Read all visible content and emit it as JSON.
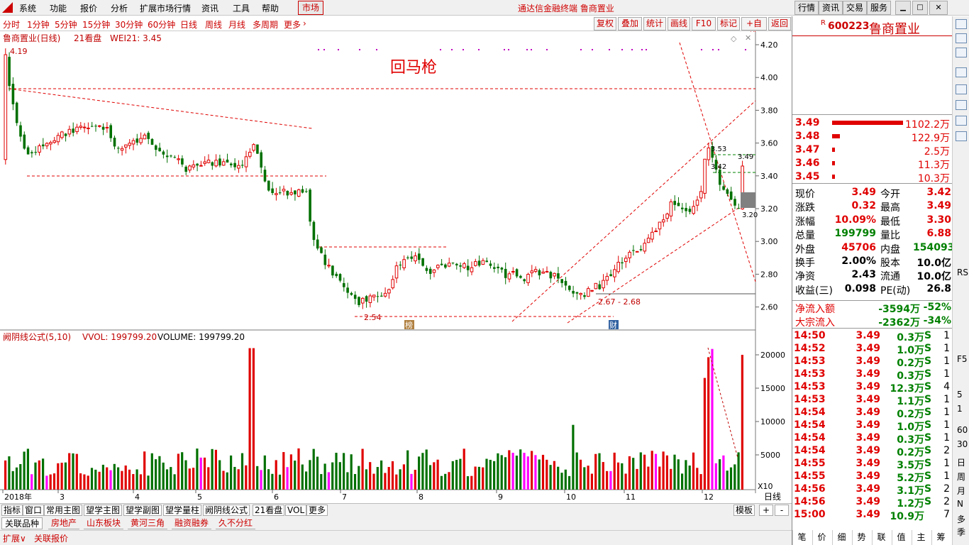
{
  "menu": {
    "items": [
      "系统",
      "功能",
      "报价",
      "分析",
      "扩展市场行情",
      "资讯",
      "工具",
      "帮助"
    ],
    "market_tab": "市场",
    "center_title": "通达信金融终端  鲁商置业",
    "right_buttons": [
      "行情",
      "资讯",
      "交易",
      "服务"
    ]
  },
  "periods": {
    "items": [
      "分时",
      "1分钟",
      "5分钟",
      "15分钟",
      "30分钟",
      "60分钟",
      "日线",
      "周线",
      "月线",
      "多周期",
      "更多"
    ],
    "tools": [
      "复权",
      "叠加",
      "统计",
      "画线",
      "F10",
      "标记",
      "+自选",
      "返回"
    ]
  },
  "chart": {
    "title_stock": "鲁商置业(日线)",
    "title_extra": "21看盘",
    "title_wei": "WEI21: 3.45",
    "annotation": "回马枪",
    "y_ticks": [
      "4.20",
      "4.00",
      "3.80",
      "3.60",
      "3.40",
      "3.20",
      "3.00",
      "2.80",
      "2.60"
    ],
    "labels": {
      "high": "4.19",
      "low": "2.54",
      "range": "2.67 - 2.68",
      "p353": "3.53",
      "p342": "3.42",
      "p349": "3.49",
      "p320": "3.20"
    },
    "markers": [
      "榜",
      "财"
    ],
    "vol_title": "阙阴线公式(5,10)",
    "vol_vvol": "VVOL: 199799.20",
    "vol_volume": "VOLUME: 199799.20",
    "vol_ticks": [
      "20000",
      "15000",
      "10000",
      "5000"
    ],
    "vol_unit": "X10",
    "x_labels": [
      "2018年",
      "3",
      "4",
      "5",
      "6",
      "7",
      "8",
      "9",
      "10",
      "11",
      "12"
    ],
    "period_label": "日线",
    "colors": {
      "up": "#e00000",
      "down": "#007000",
      "magenta": "#ff00ff",
      "num_label": "#00a0a0"
    }
  },
  "bottom": {
    "tabs": [
      "指标",
      "窗口",
      "常用主图",
      "望学主图",
      "望学副图",
      "望学量柱",
      "阙阴线公式",
      "21看盘",
      "VOL",
      "更多"
    ],
    "right": [
      "模板",
      "+",
      "-"
    ]
  },
  "sectors": [
    "关联品种",
    "房地产",
    "山东板块",
    "黄河三角",
    "融资融券",
    "久不分红"
  ],
  "ext": [
    "扩展∨",
    "关联报价"
  ],
  "right_panel": {
    "code": "600223",
    "name": "鲁商置业",
    "r_mark": "R",
    "order_book": [
      {
        "price": "3.49",
        "vol": "1102.2万",
        "bar": 1.0
      },
      {
        "price": "3.48",
        "vol": "122.9万",
        "bar": 0.11
      },
      {
        "price": "3.47",
        "vol": "2.5万",
        "bar": 0.02
      },
      {
        "price": "3.46",
        "vol": "11.3万",
        "bar": 0.02
      },
      {
        "price": "3.45",
        "vol": "10.3万",
        "bar": 0.02
      }
    ],
    "stats": [
      {
        "l1": "现价",
        "v1": "3.49",
        "c1": "red",
        "l2": "今开",
        "v2": "3.42",
        "c2": "red"
      },
      {
        "l1": "涨跌",
        "v1": "0.32",
        "c1": "red",
        "l2": "最高",
        "v2": "3.49",
        "c2": "red"
      },
      {
        "l1": "涨幅",
        "v1": "10.09%",
        "c1": "red",
        "l2": "最低",
        "v2": "3.30",
        "c2": "red"
      },
      {
        "l1": "总量",
        "v1": "199799",
        "c1": "grn",
        "l2": "量比",
        "v2": "6.88",
        "c2": "red"
      },
      {
        "l1": "外盘",
        "v1": "45706",
        "c1": "red",
        "l2": "内盘",
        "v2": "154093",
        "c2": "grn"
      },
      {
        "l1": "换手",
        "v1": "2.00%",
        "c1": "blk",
        "l2": "股本",
        "v2": "10.0亿",
        "c2": "blk"
      },
      {
        "l1": "净资",
        "v1": "2.43",
        "c1": "blk",
        "l2": "流通",
        "v2": "10.0亿",
        "c2": "blk"
      },
      {
        "l1": "收益(三)",
        "v1": "0.098",
        "c1": "blk",
        "l2": "PE(动)",
        "v2": "26.8",
        "c2": "blk"
      }
    ],
    "flows": [
      {
        "label": "净流入额",
        "v1": "-3594万",
        "v2": "-52%"
      },
      {
        "label": "大宗流入",
        "v1": "-2362万",
        "v2": "-34%"
      }
    ],
    "ticks": [
      {
        "t": "14:50",
        "p": "3.49",
        "v": "0.3万",
        "s": "S",
        "n": "1"
      },
      {
        "t": "14:52",
        "p": "3.49",
        "v": "1.0万",
        "s": "S",
        "n": "1"
      },
      {
        "t": "14:53",
        "p": "3.49",
        "v": "0.2万",
        "s": "S",
        "n": "1"
      },
      {
        "t": "14:53",
        "p": "3.49",
        "v": "0.3万",
        "s": "S",
        "n": "1"
      },
      {
        "t": "14:53",
        "p": "3.49",
        "v": "12.3万",
        "s": "S",
        "n": "4"
      },
      {
        "t": "14:53",
        "p": "3.49",
        "v": "1.1万",
        "s": "S",
        "n": "1"
      },
      {
        "t": "14:54",
        "p": "3.49",
        "v": "0.2万",
        "s": "S",
        "n": "1"
      },
      {
        "t": "14:54",
        "p": "3.49",
        "v": "1.0万",
        "s": "S",
        "n": "1"
      },
      {
        "t": "14:54",
        "p": "3.49",
        "v": "0.3万",
        "s": "S",
        "n": "1"
      },
      {
        "t": "14:54",
        "p": "3.49",
        "v": "0.2万",
        "s": "S",
        "n": "2"
      },
      {
        "t": "14:55",
        "p": "3.49",
        "v": "3.5万",
        "s": "S",
        "n": "1"
      },
      {
        "t": "14:55",
        "p": "3.49",
        "v": "5.2万",
        "s": "S",
        "n": "1"
      },
      {
        "t": "14:56",
        "p": "3.49",
        "v": "3.1万",
        "s": "S",
        "n": "2"
      },
      {
        "t": "14:56",
        "p": "3.49",
        "v": "1.2万",
        "s": "S",
        "n": "2"
      },
      {
        "t": "15:00",
        "p": "3.49",
        "v": "10.9万",
        "s": "",
        "n": "7"
      }
    ],
    "footer": [
      "笔",
      "价",
      "细",
      "势",
      "联",
      "值",
      "主",
      "筹"
    ]
  },
  "right_strip": {
    "texts": [
      "RSI",
      "F5",
      "日",
      "周",
      "月",
      "N",
      "多",
      "季",
      "30",
      "60",
      "5",
      "1"
    ],
    "icons": [
      "chevron-up-icon",
      "cross-icon",
      "down-arrow-icon",
      "chart-icon",
      "list-icon",
      "zoom-icon",
      "compass-icon",
      "pencil-icon"
    ]
  }
}
